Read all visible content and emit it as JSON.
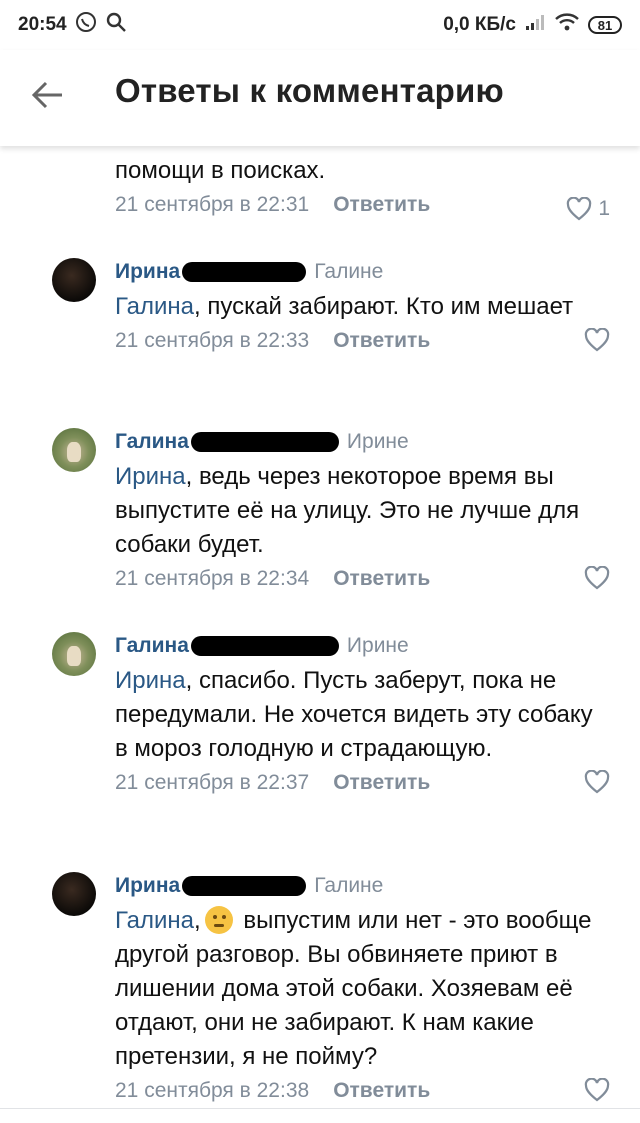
{
  "status_bar": {
    "time": "20:54",
    "net_speed": "0,0 КБ/с",
    "battery": "81",
    "icons": [
      "whatsapp-icon",
      "search-icon",
      "signal-icon",
      "wifi-icon",
      "battery-icon"
    ]
  },
  "header": {
    "title": "Ответы к комментарию",
    "back_icon": "arrow-left-icon"
  },
  "partial_comment": {
    "text": "помощи в поисках.",
    "date": "21 сентября в 22:31",
    "reply_label": "Ответить",
    "like_count": "1"
  },
  "comments": [
    {
      "author": "Ирина",
      "reply_to": "Галине",
      "mention": "Галина",
      "text": ", пускай забирают. Кто им мешает",
      "date": "21 сентября в 22:33",
      "reply_label": "Ответить"
    },
    {
      "author": "Галина",
      "reply_to": "Ирине",
      "mention": "Ирина",
      "text": ", ведь через некоторое время вы выпустите её на улицу. Это не лучше для собаки будет.",
      "date": "21 сентября в 22:34",
      "reply_label": "Ответить"
    },
    {
      "author": "Галина",
      "reply_to": "Ирине",
      "mention": "Ирина",
      "text": ", спасибо. Пусть заберут, пока не передумали. Не хочется видеть эту собаку в мороз голодную и страдающую.",
      "date": "21 сентября в 22:37",
      "reply_label": "Ответить"
    },
    {
      "author": "Ирина",
      "reply_to": "Галине",
      "mention": "Галина",
      "text": " выпустим или нет - это вообще другой разговор. Вы обвиняете приют в лишении дома этой собаки. Хозяевам её отдают, они не забирают. К нам какие претензии, я не пойму?",
      "date": "21 сентября в 22:38",
      "reply_label": "Ответить"
    }
  ],
  "colors": {
    "link": "#2a5885",
    "secondary": "#818c99"
  }
}
